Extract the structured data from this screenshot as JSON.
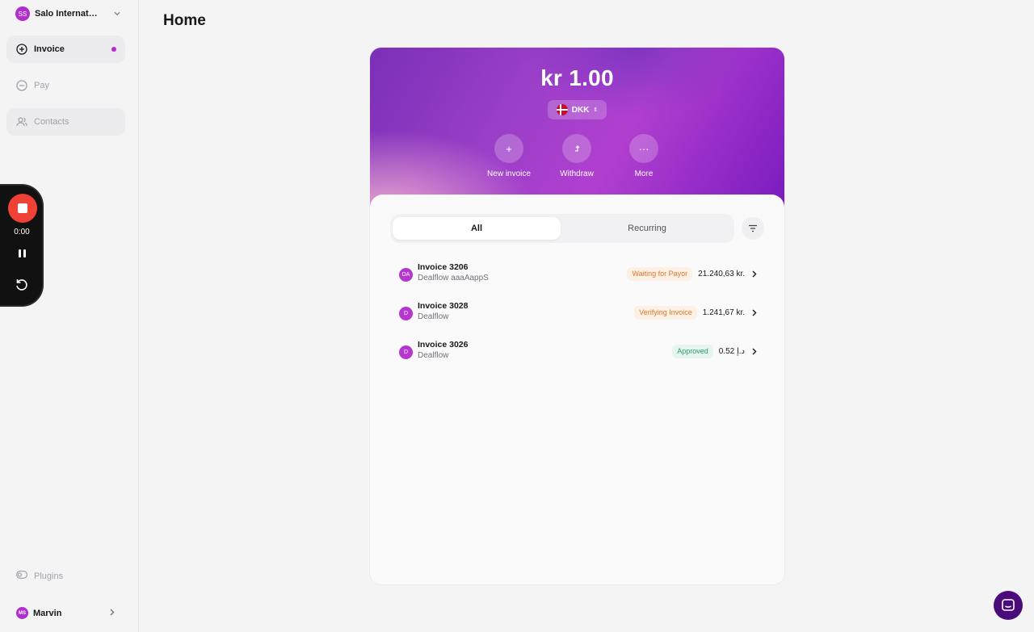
{
  "sidebar": {
    "org": {
      "initials": "SS",
      "name": "Salo International"
    },
    "items": [
      {
        "label": "Invoice"
      },
      {
        "label": "Pay"
      },
      {
        "label": "Contacts"
      }
    ],
    "plugins_label": "Plugins",
    "user": {
      "initials": "MS",
      "name": "Marvin"
    }
  },
  "recorder": {
    "time": "0:00"
  },
  "page": {
    "title": "Home"
  },
  "hero": {
    "balance": "kr 1.00",
    "currency": "DKK",
    "actions": [
      {
        "label": "New invoice",
        "icon": "plus-icon"
      },
      {
        "label": "Withdraw",
        "icon": "withdraw-icon"
      },
      {
        "label": "More",
        "icon": "more-icon"
      }
    ]
  },
  "tabs": [
    {
      "label": "All"
    },
    {
      "label": "Recurring"
    }
  ],
  "invoices": [
    {
      "initials": "DA",
      "title": "Invoice 3206",
      "contact": "Dealflow aaaAappS",
      "status": "Waiting for Payor",
      "status_color": "#e0752b",
      "amount": "21.240,63 kr."
    },
    {
      "initials": "D",
      "title": "Invoice 3028",
      "contact": "Dealflow",
      "status": "Verifying Invoice",
      "status_color": "#e0752b",
      "amount": "1.241,67 kr."
    },
    {
      "initials": "D",
      "title": "Invoice 3026",
      "contact": "Dealflow",
      "status": "Approved",
      "status_color": "#2f9a6a",
      "amount": "د.إ 0.52"
    }
  ],
  "colors": {
    "accent": "#b02ecd",
    "record": "#ef4135",
    "support": "#4a0c7a"
  }
}
